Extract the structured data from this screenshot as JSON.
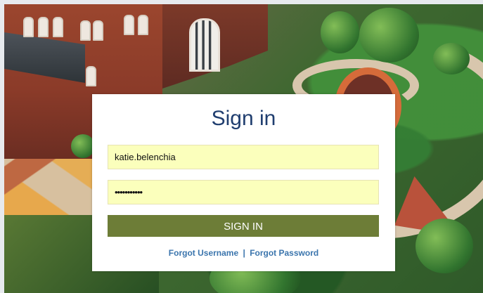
{
  "signin": {
    "title": "Sign in",
    "username_value": "katie.belenchia",
    "password_mask": "•••••••••••",
    "button_label": "SIGN IN",
    "forgot_username": "Forgot Username",
    "separator": "|",
    "forgot_password": "Forgot Password"
  },
  "colors": {
    "title": "#203e6f",
    "input_background": "#fbffbc",
    "button": "#6d7d37",
    "link": "#3b75ad"
  },
  "icons": {
    "background_image": "campus-aerial-photo"
  }
}
